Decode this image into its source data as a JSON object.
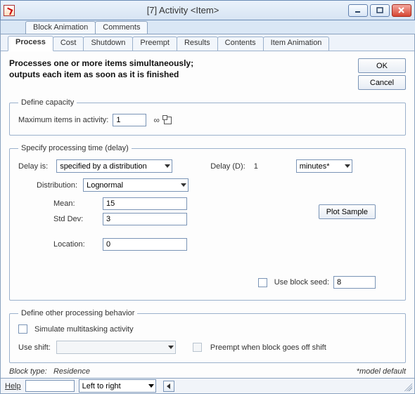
{
  "title": "[7]   Activity   <Item>",
  "win_buttons": {
    "minimize": "minimize",
    "maximize": "maximize",
    "close": "close"
  },
  "outer_tabs": [
    "Block Animation",
    "Comments"
  ],
  "inner_tabs": [
    "Process",
    "Cost",
    "Shutdown",
    "Preempt",
    "Results",
    "Contents",
    "Item Animation"
  ],
  "inner_tabs_active_index": 0,
  "description_line1": "Processes one or more items simultaneously;",
  "description_line2": "outputs each item as soon as it is finished",
  "buttons": {
    "ok": "OK",
    "cancel": "Cancel",
    "plot_sample": "Plot Sample"
  },
  "capacity_group": {
    "legend": "Define capacity",
    "max_label": "Maximum items in activity:",
    "max_value": "1"
  },
  "processing_group": {
    "legend": "Specify processing time (delay)",
    "delay_is_label": "Delay is:",
    "delay_is_value": "specified by a distribution",
    "delay_d_label": "Delay (D):",
    "delay_d_value": "1",
    "delay_units_value": "minutes*",
    "distribution_label": "Distribution:",
    "distribution_value": "Lognormal",
    "params": [
      {
        "label": "Mean:",
        "value": "15"
      },
      {
        "label": "Std Dev:",
        "value": "3"
      },
      {
        "label": "Location:",
        "value": "0"
      }
    ],
    "use_block_seed_label": "Use block seed:",
    "use_block_seed_value": "8"
  },
  "other_group": {
    "legend": "Define other processing behavior",
    "simulate_label": "Simulate multitasking activity",
    "use_shift_label": "Use shift:",
    "use_shift_value": "",
    "preempt_label": "Preempt when block goes off shift"
  },
  "footer": {
    "block_type_label": "Block type:",
    "block_type_value": "Residence",
    "model_default": "*model default"
  },
  "bottombar": {
    "help": "Help",
    "help_value": "",
    "direction_value": "Left to right"
  }
}
